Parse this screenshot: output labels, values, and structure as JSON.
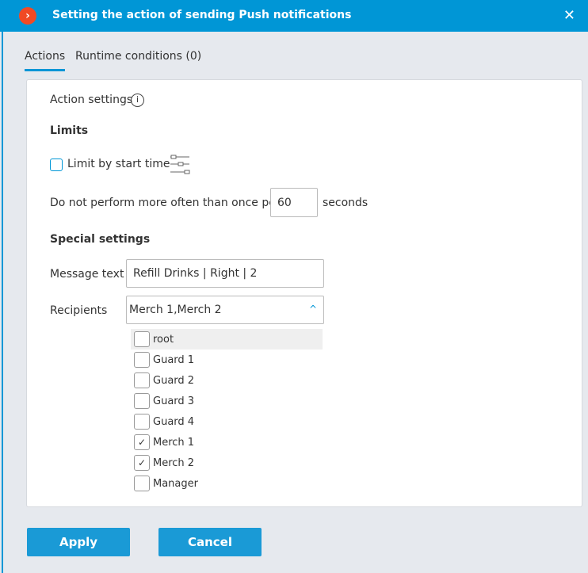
{
  "header": {
    "title": "Setting the action of sending Push notifications",
    "close": "✕",
    "logo": "›"
  },
  "tabs": [
    {
      "label": "Actions"
    },
    {
      "label": "Runtime conditions (0)"
    }
  ],
  "action_settings": "Action settings",
  "info_icon": "i",
  "limits": {
    "heading": "Limits",
    "limit_start_time": "Limit by start time",
    "limit_checked": false,
    "once_per_prefix": "Do not perform more often than once per",
    "once_per_value": "60",
    "once_per_suffix": "seconds"
  },
  "special": {
    "heading": "Special settings",
    "message_label": "Message text",
    "message_value": "Refill Drinks | Right | 2",
    "recipients_label": "Recipients",
    "recipients_value": "Merch 1,Merch 2",
    "chevron": "^"
  },
  "recipients": [
    {
      "label": "root",
      "checked": false
    },
    {
      "label": "Guard 1",
      "checked": false
    },
    {
      "label": "Guard 2",
      "checked": false
    },
    {
      "label": "Guard 3",
      "checked": false
    },
    {
      "label": "Guard 4",
      "checked": false
    },
    {
      "label": "Merch 1",
      "checked": true
    },
    {
      "label": "Merch 2",
      "checked": true
    },
    {
      "label": "Manager",
      "checked": false
    }
  ],
  "buttons": {
    "apply": "Apply",
    "cancel": "Cancel"
  },
  "colors": {
    "accent": "#0096d6",
    "logo": "#f04a24",
    "button": "#1a9ad6"
  }
}
